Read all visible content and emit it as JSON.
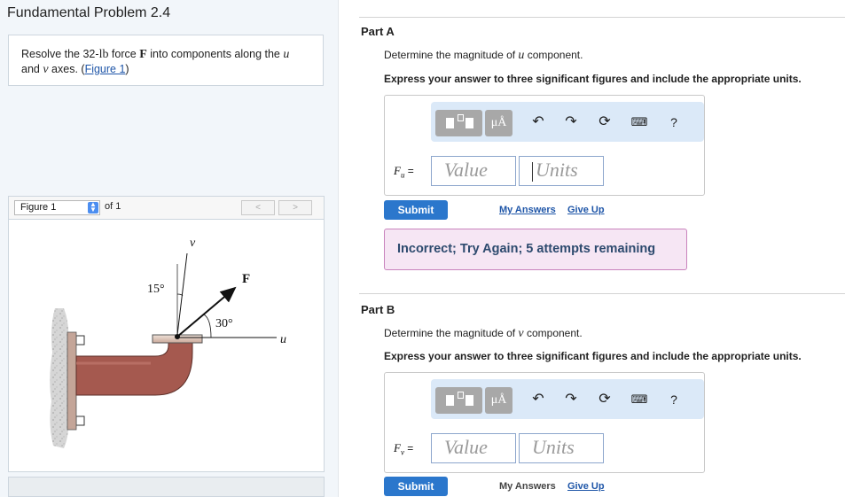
{
  "problem_title": "Fundamental Problem 2.4",
  "problem": {
    "text_1": "Resolve the 32-",
    "unit": "lb",
    "text_2": " force ",
    "force_symbol": "F",
    "text_3": " into components along the ",
    "u_axis": "u",
    "text_4": "and ",
    "v_axis": "v",
    "text_5": " axes. (",
    "figure_link": "Figure 1",
    "text_6": ")"
  },
  "figure_nav": {
    "select_value": "Figure 1",
    "of_text": "of 1",
    "prev": "<",
    "next": ">"
  },
  "figure": {
    "v_label": "v",
    "u_label": "u",
    "f_label": "F",
    "angle_15": "15°",
    "angle_30": "30°"
  },
  "toolbar": {
    "templates_icon": "fraction-template-icon",
    "units_button": "μÅ",
    "undo_icon": "undo-icon",
    "redo_icon": "redo-icon",
    "reset_icon": "reset-icon",
    "keyboard_icon": "keyboard-icon",
    "help": "?"
  },
  "part_a": {
    "label": "Part A",
    "question_1": "Determine the magnitude of ",
    "question_var": "u",
    "question_2": " component.",
    "instruction": "Express your answer to three significant figures and include the appropriate units.",
    "var_label": "F",
    "var_sub": "u",
    "equals": "=",
    "value_placeholder": "Value",
    "units_placeholder": "Units",
    "submit": "Submit",
    "my_answers": "My Answers",
    "give_up": "Give Up",
    "feedback": "Incorrect; Try Again; 5 attempts remaining"
  },
  "part_b": {
    "label": "Part B",
    "question_1": "Determine the magnitude of ",
    "question_var": "v",
    "question_2": " component.",
    "instruction": "Express your answer to three significant figures and include the appropriate units.",
    "var_label": "F",
    "var_sub": "v",
    "equals": "=",
    "value_placeholder": "Value",
    "units_placeholder": "Units",
    "submit": "Submit",
    "my_answers": "My Answers",
    "give_up": "Give Up"
  },
  "colors": {
    "submit": "#2b77cc",
    "link": "#1f56a8",
    "feedback_bg": "#f6e6f4",
    "feedback_border": "#c983bd",
    "pipe": "#a5594f"
  }
}
